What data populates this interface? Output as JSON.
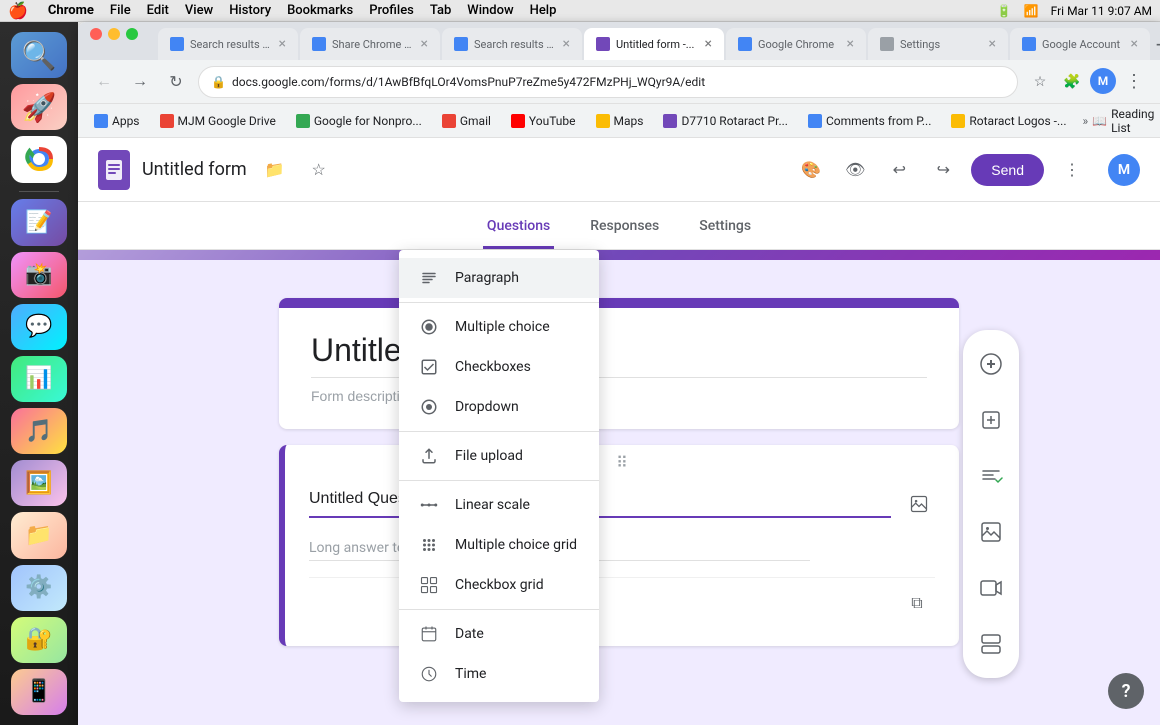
{
  "menubar": {
    "apple": "🍎",
    "items": [
      "Chrome",
      "File",
      "Edit",
      "View",
      "History",
      "Bookmarks",
      "Profiles",
      "Tab",
      "Window",
      "Help"
    ],
    "right": {
      "time": "Fri Mar 11  9:07 AM",
      "wifi": "wifi",
      "battery": "battery"
    }
  },
  "window_controls": {
    "close": "×",
    "minimize": "–",
    "maximize": "+"
  },
  "tabs": [
    {
      "label": "Search results -...",
      "favicon": "search",
      "active": false
    },
    {
      "label": "Share Chrome w...",
      "favicon": "google",
      "active": false
    },
    {
      "label": "Search results -...",
      "favicon": "search",
      "active": false
    },
    {
      "label": "Untitled form -...",
      "favicon": "forms",
      "active": true
    },
    {
      "label": "Google Chrome",
      "favicon": "google",
      "active": false
    },
    {
      "label": "Settings",
      "favicon": "gear",
      "active": false
    },
    {
      "label": "Google Account",
      "favicon": "google",
      "active": false
    }
  ],
  "address_bar": {
    "url": "docs.google.com/forms/d/1AwBfBfqLOr4VomsPnuP7reZme5y472FMzPHj_WQyr9A/edit"
  },
  "bookmarks": [
    {
      "label": "Apps",
      "type": "apps"
    },
    {
      "label": "MJM Google Drive",
      "type": "mjm"
    },
    {
      "label": "Google for Nonpro...",
      "type": "gnp"
    },
    {
      "label": "Gmail",
      "type": "gmail"
    },
    {
      "label": "YouTube",
      "type": "yt"
    },
    {
      "label": "Maps",
      "type": "maps"
    },
    {
      "label": "D7710 Rotaract Pr...",
      "type": "rotaract"
    },
    {
      "label": "Comments from P...",
      "type": "comments"
    },
    {
      "label": "Rotaract Logos -...",
      "type": "logos"
    }
  ],
  "forms_header": {
    "title": "Untitled form",
    "send_label": "Send",
    "profile_initial": "M"
  },
  "forms_nav": {
    "tabs": [
      "Questions",
      "Responses",
      "Settings"
    ],
    "active": "Questions"
  },
  "form": {
    "title": "Untitled form",
    "description": "Form description"
  },
  "question": {
    "title": "Untitled Question",
    "answer_placeholder": "Long answer text"
  },
  "dropdown_menu": {
    "items": [
      {
        "label": "Paragraph",
        "icon": "paragraph"
      },
      {
        "label": "Multiple choice",
        "icon": "radio"
      },
      {
        "label": "Checkboxes",
        "icon": "checkbox"
      },
      {
        "label": "Dropdown",
        "icon": "dropdown"
      },
      {
        "label": "File upload",
        "icon": "upload"
      },
      {
        "label": "Linear scale",
        "icon": "scale"
      },
      {
        "label": "Multiple choice grid",
        "icon": "grid"
      },
      {
        "label": "Checkbox grid",
        "icon": "checkgrid"
      },
      {
        "label": "Date",
        "icon": "calendar"
      },
      {
        "label": "Time",
        "icon": "clock"
      }
    ]
  },
  "right_toolbar": {
    "buttons": [
      "add_question",
      "add_title",
      "add_text",
      "add_image",
      "add_video",
      "add_section"
    ]
  }
}
